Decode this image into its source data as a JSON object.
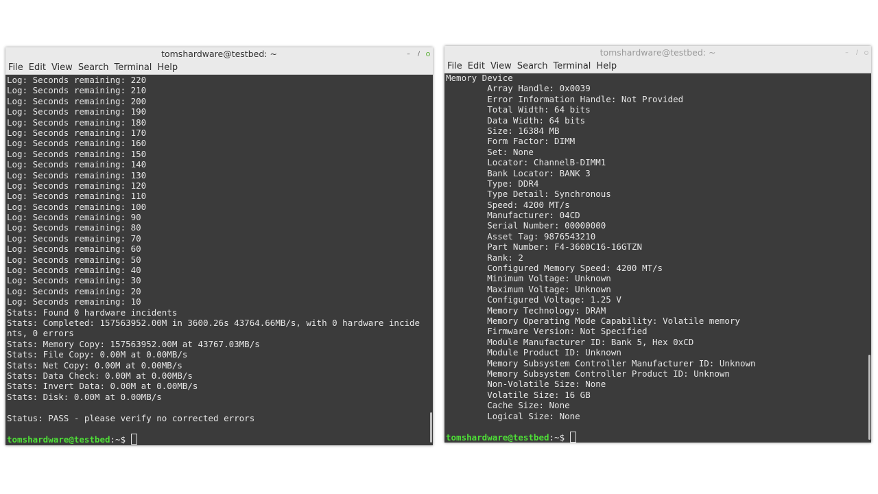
{
  "left_window": {
    "title": "tomshardware@testbed: ~",
    "menu": [
      "File",
      "Edit",
      "View",
      "Search",
      "Terminal",
      "Help"
    ],
    "lines": [
      "Log: Seconds remaining: 220",
      "Log: Seconds remaining: 210",
      "Log: Seconds remaining: 200",
      "Log: Seconds remaining: 190",
      "Log: Seconds remaining: 180",
      "Log: Seconds remaining: 170",
      "Log: Seconds remaining: 160",
      "Log: Seconds remaining: 150",
      "Log: Seconds remaining: 140",
      "Log: Seconds remaining: 130",
      "Log: Seconds remaining: 120",
      "Log: Seconds remaining: 110",
      "Log: Seconds remaining: 100",
      "Log: Seconds remaining: 90",
      "Log: Seconds remaining: 80",
      "Log: Seconds remaining: 70",
      "Log: Seconds remaining: 60",
      "Log: Seconds remaining: 50",
      "Log: Seconds remaining: 40",
      "Log: Seconds remaining: 30",
      "Log: Seconds remaining: 20",
      "Log: Seconds remaining: 10",
      "Stats: Found 0 hardware incidents",
      "Stats: Completed: 157563952.00M in 3600.26s 43764.66MB/s, with 0 hardware incide",
      "nts, 0 errors",
      "Stats: Memory Copy: 157563952.00M at 43767.03MB/s",
      "Stats: File Copy: 0.00M at 0.00MB/s",
      "Stats: Net Copy: 0.00M at 0.00MB/s",
      "Stats: Data Check: 0.00M at 0.00MB/s",
      "Stats: Invert Data: 0.00M at 0.00MB/s",
      "Stats: Disk: 0.00M at 0.00MB/s",
      "",
      "Status: PASS - please verify no corrected errors",
      ""
    ],
    "prompt_user": "tomshardware@testbed",
    "prompt_path": ":~$ "
  },
  "right_window": {
    "title": "tomshardware@testbed: ~",
    "menu": [
      "File",
      "Edit",
      "View",
      "Search",
      "Terminal",
      "Help"
    ],
    "lines": [
      "Memory Device",
      "        Array Handle: 0x0039",
      "        Error Information Handle: Not Provided",
      "        Total Width: 64 bits",
      "        Data Width: 64 bits",
      "        Size: 16384 MB",
      "        Form Factor: DIMM",
      "        Set: None",
      "        Locator: ChannelB-DIMM1",
      "        Bank Locator: BANK 3",
      "        Type: DDR4",
      "        Type Detail: Synchronous",
      "        Speed: 4200 MT/s",
      "        Manufacturer: 04CD",
      "        Serial Number: 00000000",
      "        Asset Tag: 9876543210",
      "        Part Number: F4-3600C16-16GTZN",
      "        Rank: 2",
      "        Configured Memory Speed: 4200 MT/s",
      "        Minimum Voltage: Unknown",
      "        Maximum Voltage: Unknown",
      "        Configured Voltage: 1.25 V",
      "        Memory Technology: DRAM",
      "        Memory Operating Mode Capability: Volatile memory",
      "        Firmware Version: Not Specified",
      "        Module Manufacturer ID: Bank 5, Hex 0xCD",
      "        Module Product ID: Unknown",
      "        Memory Subsystem Controller Manufacturer ID: Unknown",
      "        Memory Subsystem Controller Product ID: Unknown",
      "        Non-Volatile Size: None",
      "        Volatile Size: 16 GB",
      "        Cache Size: None",
      "        Logical Size: None",
      ""
    ],
    "prompt_user": "tomshardware@testbed",
    "prompt_path": ":~$ "
  },
  "colors": {
    "terminal_bg": "#3b3b3b",
    "terminal_fg": "#e6e6e6",
    "prompt_green": "#4ee037",
    "chrome_bg": "#eaeaea"
  }
}
